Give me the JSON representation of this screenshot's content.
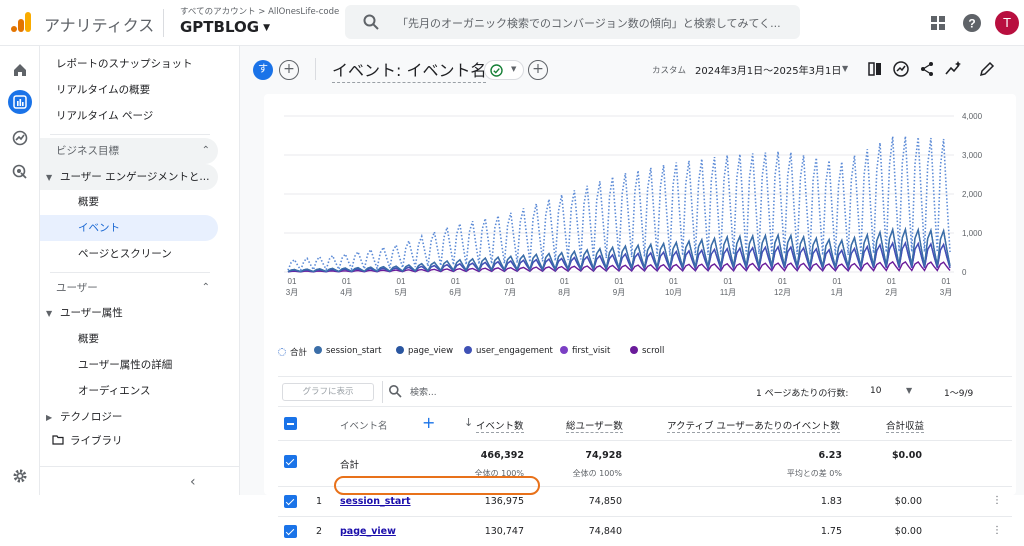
{
  "topbar": {
    "brand": "アナリティクス",
    "account_sub": "すべてのアカウント > AllOnesLife-code",
    "property": "GPTBLOG",
    "search_placeholder": "「先月のオーガニック検索でのコンバージョン数の傾向」と検索してみてく...",
    "avatar_letter": "T"
  },
  "sidebar": {
    "items": [
      {
        "label": "レポートのスナップショット"
      },
      {
        "label": "リアルタイムの概要"
      },
      {
        "label": "リアルタイム ページ"
      }
    ],
    "group_business": "ビジネス目標",
    "engagement": "ユーザー エンゲージメントと...",
    "engagement_items": [
      {
        "label": "概要"
      },
      {
        "label": "イベント"
      },
      {
        "label": "ページとスクリーン"
      }
    ],
    "group_user": "ユーザー",
    "user_attr": "ユーザー属性",
    "user_items": [
      {
        "label": "概要"
      },
      {
        "label": "ユーザー属性の詳細"
      },
      {
        "label": "オーディエンス"
      }
    ],
    "technology": "テクノロジー",
    "library": "ライブラリ"
  },
  "header": {
    "chip_letter": "す",
    "title": "イベント: イベント名",
    "date_label": "カスタム",
    "date_range": "2024年3月1日～2025年3月1日"
  },
  "chart_data": {
    "type": "line",
    "x_tick_labels": [
      {
        "day": "01",
        "month": "3月"
      },
      {
        "day": "01",
        "month": "4月"
      },
      {
        "day": "01",
        "month": "5月"
      },
      {
        "day": "01",
        "month": "6月"
      },
      {
        "day": "01",
        "month": "7月"
      },
      {
        "day": "01",
        "month": "8月"
      },
      {
        "day": "01",
        "month": "9月"
      },
      {
        "day": "01",
        "month": "10月"
      },
      {
        "day": "01",
        "month": "11月"
      },
      {
        "day": "01",
        "month": "12月"
      },
      {
        "day": "01",
        "month": "1月"
      },
      {
        "day": "01",
        "month": "2月"
      },
      {
        "day": "01",
        "month": "3月"
      }
    ],
    "y_tick_labels": [
      "4,000",
      "3,000",
      "2,000",
      "1,000",
      "0"
    ],
    "ylim": [
      0,
      4000
    ],
    "grid": true,
    "y_axis_side": "right",
    "legend_position": "bottom-left",
    "series": [
      {
        "name": "合計",
        "color": "#5b8ad6",
        "style": "dotted",
        "monthly_peak": [
          300,
          450,
          700,
          1200,
          1500,
          2000,
          2500,
          2800,
          3000,
          3100,
          2800,
          3500,
          3400
        ]
      },
      {
        "name": "session_start",
        "color": "#3b6ea8",
        "style": "solid",
        "monthly_peak": [
          60,
          100,
          150,
          300,
          400,
          500,
          650,
          750,
          900,
          950,
          800,
          1100,
          1050
        ]
      },
      {
        "name": "page_view",
        "color": "#2a56a0",
        "style": "solid",
        "monthly_peak": [
          60,
          100,
          150,
          300,
          400,
          500,
          650,
          750,
          900,
          950,
          800,
          1100,
          1050
        ]
      },
      {
        "name": "user_engagement",
        "color": "#3f51b5",
        "style": "solid",
        "monthly_peak": [
          40,
          70,
          100,
          200,
          280,
          350,
          450,
          520,
          600,
          650,
          550,
          750,
          700
        ]
      },
      {
        "name": "first_visit",
        "color": "#7b3fc4",
        "style": "solid",
        "monthly_peak": [
          40,
          70,
          100,
          200,
          280,
          350,
          450,
          520,
          600,
          650,
          550,
          750,
          700
        ]
      },
      {
        "name": "scroll",
        "color": "#6a1b9a",
        "style": "solid",
        "monthly_peak": [
          20,
          30,
          50,
          80,
          110,
          140,
          170,
          190,
          210,
          230,
          200,
          260,
          250
        ]
      }
    ]
  },
  "table": {
    "show_graph": "グラフに表示",
    "search_placeholder": "検索...",
    "rows_per_page_label": "1 ページあたりの行数:",
    "rows_per_page": "10",
    "range": "1～9/9",
    "headers": {
      "event_name": "イベント名",
      "event_count": "イベント数",
      "total_users": "総ユーザー数",
      "per_user": "アクティブ ユーザーあたりのイベント数",
      "revenue": "合計収益"
    },
    "total": {
      "label": "合計",
      "event_count": "466,392",
      "event_count_sub": "全体の 100%",
      "total_users": "74,928",
      "total_users_sub": "全体の 100%",
      "per_user": "6.23",
      "per_user_sub": "平均との差 0%",
      "revenue": "$0.00"
    },
    "rows": [
      {
        "rank": "1",
        "name": "session_start",
        "event_count": "136,975",
        "total_users": "74,850",
        "per_user": "1.83",
        "revenue": "$0.00"
      },
      {
        "rank": "2",
        "name": "page_view",
        "event_count": "130,747",
        "total_users": "74,840",
        "per_user": "1.75",
        "revenue": "$0.00"
      }
    ]
  }
}
